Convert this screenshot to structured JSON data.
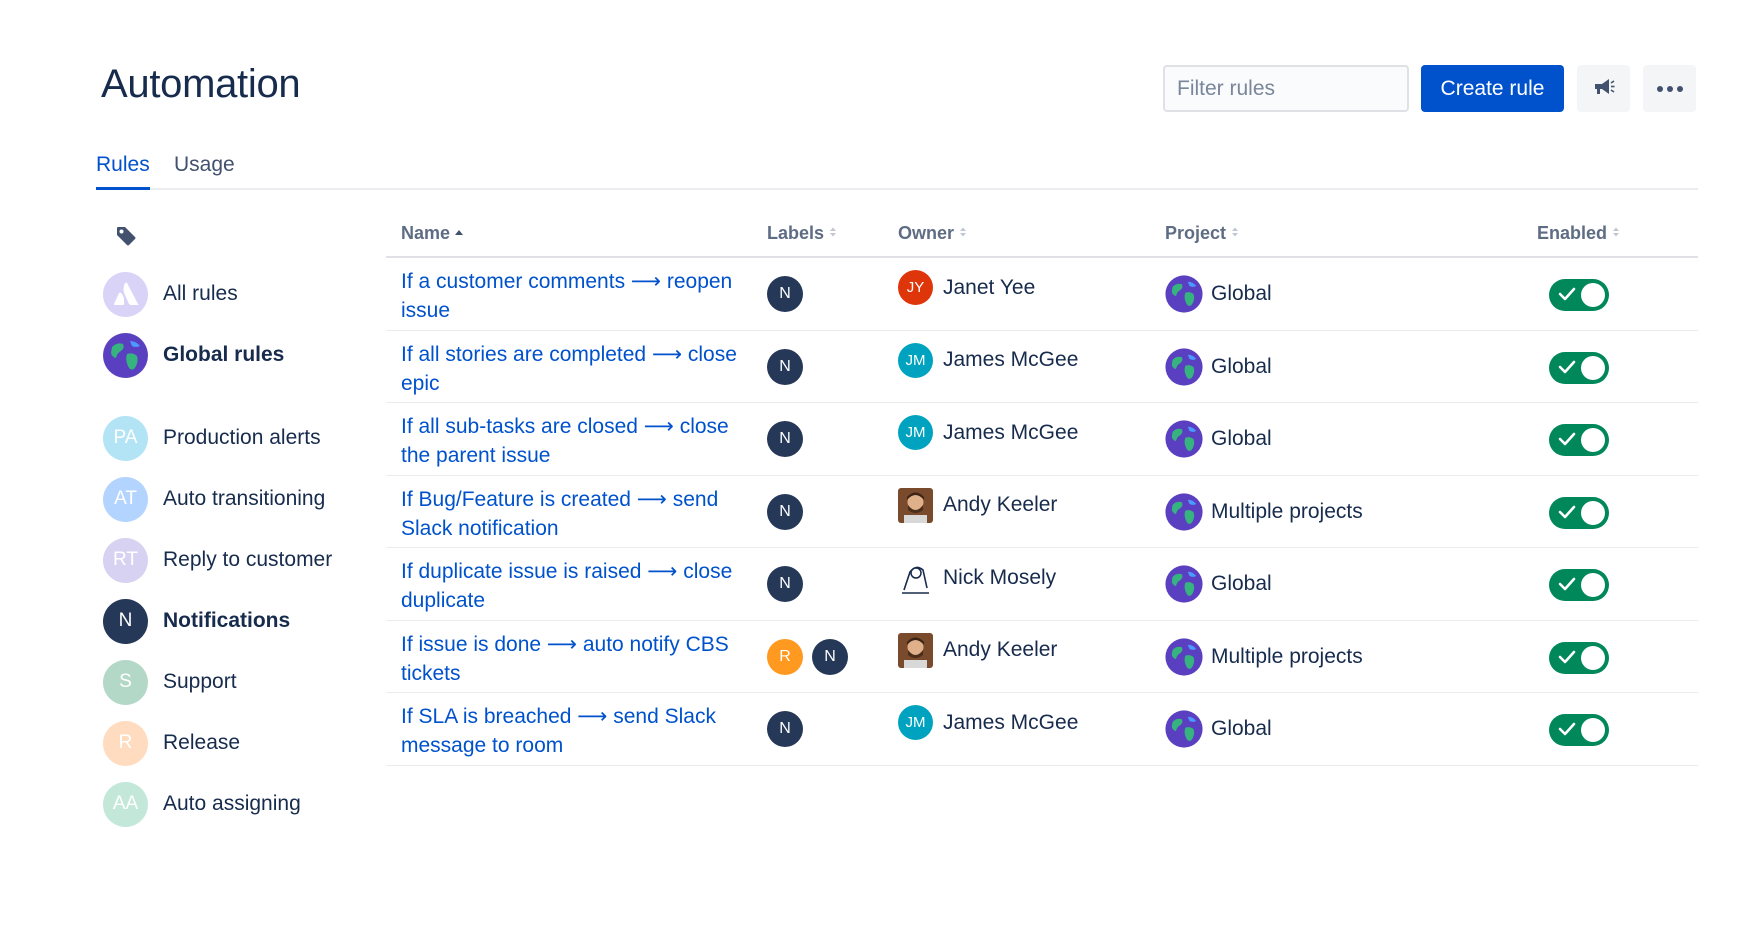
{
  "header": {
    "title": "Automation",
    "filter_placeholder": "Filter rules",
    "create_button": "Create rule",
    "feedback_icon": "megaphone-icon",
    "more_icon": "more-horizontal-icon"
  },
  "tabs": [
    {
      "label": "Rules",
      "active": true
    },
    {
      "label": "Usage",
      "active": false
    }
  ],
  "sidebar": {
    "label_icon": "tag-icon",
    "items": [
      {
        "label": "All rules",
        "avatar": "",
        "color": "#c0b6f2",
        "bold": false
      },
      {
        "label": "Global rules",
        "avatar": "",
        "color": "#6554c0",
        "bold": true
      },
      {
        "label": "Production alerts",
        "avatar": "PA",
        "color": "#b3e4f5",
        "bold": false
      },
      {
        "label": "Auto transitioning",
        "avatar": "AT",
        "color": "#b3d4ff",
        "bold": false
      },
      {
        "label": "Reply to customer",
        "avatar": "RT",
        "color": "#d7d2f2",
        "bold": false
      },
      {
        "label": "Notifications",
        "avatar": "N",
        "color": "#253858",
        "bold": true
      },
      {
        "label": "Support",
        "avatar": "S",
        "color": "#b3d8c8",
        "bold": false
      },
      {
        "label": "Release",
        "avatar": "R",
        "color": "#ffdcbf",
        "bold": false
      },
      {
        "label": "Auto assigning",
        "avatar": "AA",
        "color": "#c3e8d9",
        "bold": false
      }
    ]
  },
  "table": {
    "columns": [
      "Name",
      "Labels",
      "Owner",
      "Project",
      "Enabled"
    ],
    "rows": [
      {
        "name": "If a customer comments ⟶ reopen issue",
        "labels": [
          {
            "text": "N",
            "color": "#253858"
          }
        ],
        "owner": "Janet Yee",
        "owner_initials": "JY",
        "owner_color": "#de350b",
        "project": "Global",
        "enabled": true
      },
      {
        "name": "If all stories are completed ⟶ close epic",
        "labels": [
          {
            "text": "N",
            "color": "#253858"
          }
        ],
        "owner": "James McGee",
        "owner_initials": "JM",
        "owner_color": "#00a3bf",
        "project": "Global",
        "enabled": true
      },
      {
        "name": "If all sub-tasks are closed ⟶ close the parent issue",
        "labels": [
          {
            "text": "N",
            "color": "#253858"
          }
        ],
        "owner": "James McGee",
        "owner_initials": "JM",
        "owner_color": "#00a3bf",
        "project": "Global",
        "enabled": true
      },
      {
        "name": "If Bug/Feature is created ⟶ send Slack notification",
        "labels": [
          {
            "text": "N",
            "color": "#253858"
          }
        ],
        "owner": "Andy Keeler",
        "owner_initials": "",
        "owner_color": "#8a5a3c",
        "project": "Multiple projects",
        "enabled": true
      },
      {
        "name": "If duplicate issue is raised ⟶ close duplicate",
        "labels": [
          {
            "text": "N",
            "color": "#253858"
          }
        ],
        "owner": "Nick Mosely",
        "owner_initials": "",
        "owner_color": "#f4f5f7",
        "project": "Global",
        "enabled": true
      },
      {
        "name": "If issue is done ⟶ auto notify CBS tickets",
        "labels": [
          {
            "text": "R",
            "color": "#ff991f"
          },
          {
            "text": "N",
            "color": "#253858"
          }
        ],
        "owner": "Andy Keeler",
        "owner_initials": "",
        "owner_color": "#8a5a3c",
        "project": "Multiple projects",
        "enabled": true
      },
      {
        "name": "If SLA is breached ⟶ send Slack message to room",
        "labels": [
          {
            "text": "N",
            "color": "#253858"
          }
        ],
        "owner": "James McGee",
        "owner_initials": "JM",
        "owner_color": "#00a3bf",
        "project": "Global",
        "enabled": true
      }
    ]
  },
  "colors": {
    "primary": "#0052cc",
    "toggle_on": "#00875a",
    "text": "#172b4d"
  }
}
